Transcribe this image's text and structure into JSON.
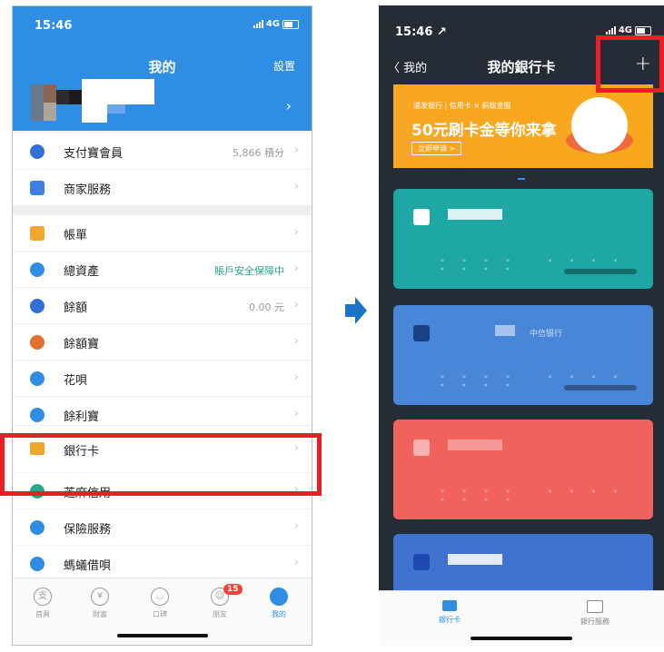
{
  "left": {
    "status": {
      "time": "15:46",
      "network": "4G"
    },
    "header": {
      "title": "我的",
      "settings": "設置",
      "chevron": "›"
    },
    "rows": [
      {
        "label": "支付寶會員",
        "value": "5,866 積分",
        "icon_color": "#2f6fd6",
        "value_style": "gray"
      },
      {
        "label": "商家服務",
        "value": "",
        "icon_color": "#3d7fe0",
        "value_style": "gray"
      },
      {
        "label": "帳單",
        "value": "",
        "icon_color": "#f3a530",
        "value_style": "gray"
      },
      {
        "label": "總資產",
        "value": "賬戶安全保障中",
        "icon_color": "#2f8de4",
        "value_style": "green"
      },
      {
        "label": "餘額",
        "value": "0.00 元",
        "icon_color": "#2f6fd6",
        "value_style": "gray"
      },
      {
        "label": "餘額寶",
        "value": "",
        "icon_color": "#e2702f",
        "value_style": "gray"
      },
      {
        "label": "花唄",
        "value": "",
        "icon_color": "#2f8de4",
        "value_style": "gray"
      },
      {
        "label": "餘利寶",
        "value": "",
        "icon_color": "#2f8de4",
        "value_style": "gray"
      },
      {
        "label": "銀行卡",
        "value": "",
        "icon_color": "#f0a62c",
        "value_style": "gray"
      },
      {
        "label": "芝麻信用",
        "value": "",
        "icon_color": "#2aa88a",
        "value_style": "gray"
      },
      {
        "label": "保險服務",
        "value": "",
        "icon_color": "#2f8de4",
        "value_style": "gray"
      },
      {
        "label": "螞蟻借唄",
        "value": "",
        "icon_color": "#2f8de4",
        "value_style": "gray"
      }
    ],
    "arrow": "›",
    "tabs": [
      {
        "label": "首頁",
        "icon": "支"
      },
      {
        "label": "財富",
        "icon": "¥"
      },
      {
        "label": "口碑",
        "icon": "◡"
      },
      {
        "label": "朋友",
        "icon": "☺",
        "badge": "15"
      },
      {
        "label": "我的",
        "icon": "●"
      }
    ]
  },
  "right": {
    "status": {
      "time": "15:46 ↗",
      "network": "4G"
    },
    "header": {
      "back": "〈 我的",
      "title": "我的銀行卡",
      "add": "+"
    },
    "banner": {
      "logo": "浦发银行 | 信用卡 × 蚂蚁金服",
      "headline": "50元刷卡金等你来拿",
      "cta": "立即申请 >"
    },
    "cards": [
      {
        "color": "#1fa7a5",
        "stars": "****  ****  ****",
        "tag": ""
      },
      {
        "color": "#4a86d8",
        "stars": "****  ****  ****",
        "tag": "中信银行"
      },
      {
        "color": "#f2625c",
        "stars": "****  ****  ****",
        "tag": ""
      },
      {
        "color": "#3f73cf",
        "stars": "",
        "tag": ""
      }
    ],
    "tabs": [
      {
        "label": "銀行卡",
        "active": true
      },
      {
        "label": "銀行服務",
        "active": false
      }
    ]
  }
}
